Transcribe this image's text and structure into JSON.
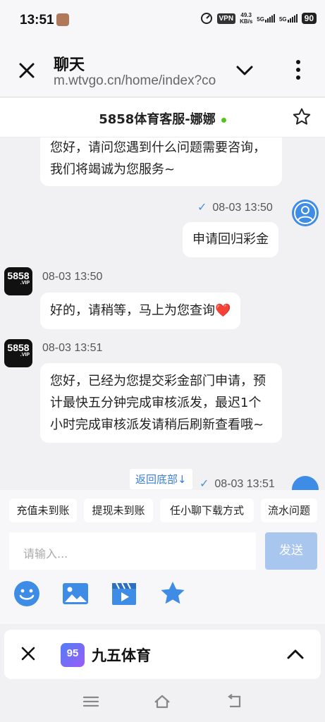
{
  "status_bar": {
    "time": "13:51",
    "vpn": "VPN",
    "speed_value": "49.3",
    "speed_unit": "KB/s",
    "net1": "5G",
    "net2": "5G",
    "battery": "90"
  },
  "header": {
    "title": "聊天",
    "url": "m.wtvgo.cn/home/index?co"
  },
  "chat": {
    "title": "5858体育客服-娜娜",
    "messages": [
      {
        "from": "agent",
        "text": "您好，请问您遇到什么问题需要咨询，我们将竭诚为您服务~"
      },
      {
        "from": "user",
        "time": "08-03 13:50",
        "text": "申请回归彩金"
      },
      {
        "from": "agent",
        "time": "08-03 13:50",
        "text": "好的，请稍等，马上为您查询❤️"
      },
      {
        "from": "agent",
        "time": "08-03 13:51",
        "text": "您好，已经为您提交彩金部门申请，预计最快五分钟完成审核派发，最迟1个小时完成审核派发请稍后刷新查看哦~"
      },
      {
        "from": "user",
        "time": "08-03 13:51"
      }
    ],
    "agent_avatar_text": "5858",
    "agent_avatar_sub": ".VIP",
    "back_to_bottom": "返回底部↓"
  },
  "quick_replies": [
    "充值未到账",
    "提现未到账",
    "任小聊下载方式",
    "流水问题"
  ],
  "composer": {
    "placeholder": "请输入...",
    "send_label": "发送"
  },
  "bottom_card": {
    "logo_text": "95",
    "title": "九五体育"
  },
  "colors": {
    "accent": "#3e8ce6",
    "send_disabled": "#a9c6ef",
    "online": "#52c41a"
  }
}
